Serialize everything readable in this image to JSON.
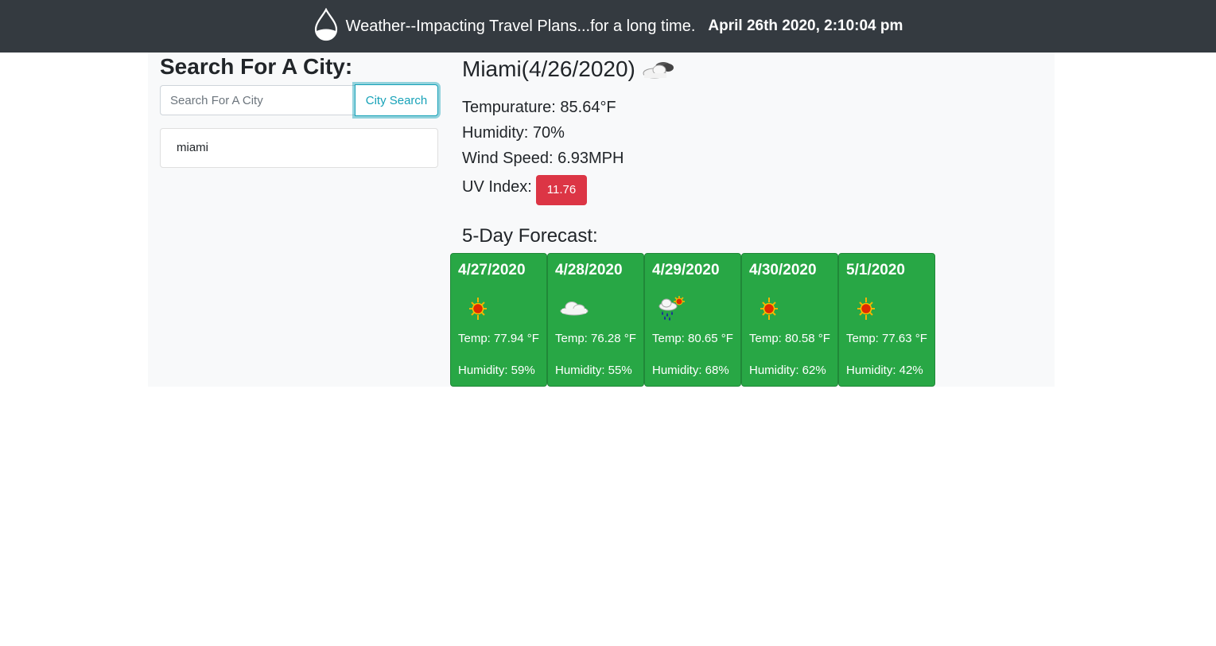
{
  "header": {
    "title": "Weather--Impacting Travel Plans...for a long time.",
    "datetime": "April 26th 2020, 2:10:04 pm",
    "logo_icon": "water-drop-icon"
  },
  "search": {
    "heading": "Search For A City:",
    "placeholder": "Search For A City",
    "button_label": "City Search",
    "history": [
      "miami"
    ]
  },
  "current": {
    "city_heading": "Miami(4/26/2020)",
    "icon": "partly-cloudy-icon",
    "temperature": "Tempurature: 85.64°F",
    "humidity": "Humidity: 70%",
    "wind": "Wind Speed: 6.93MPH",
    "uv_label": "UV Index:",
    "uv_value": "11.76",
    "uv_color": "#dc3545"
  },
  "forecast": {
    "heading": "5-Day Forecast:",
    "card_color": "#28a745",
    "days": [
      {
        "date": "4/27/2020",
        "icon": "sun-icon",
        "temp": "Temp: 77.94 °F",
        "humidity": "Humidity: 59%"
      },
      {
        "date": "4/28/2020",
        "icon": "cloud-icon",
        "temp": "Temp: 76.28 °F",
        "humidity": "Humidity: 55%"
      },
      {
        "date": "4/29/2020",
        "icon": "rain-sun-icon",
        "temp": "Temp: 80.65 °F",
        "humidity": "Humidity: 68%"
      },
      {
        "date": "4/30/2020",
        "icon": "sun-icon",
        "temp": "Temp: 80.58 °F",
        "humidity": "Humidity: 62%"
      },
      {
        "date": "5/1/2020",
        "icon": "sun-icon",
        "temp": "Temp: 77.63 °F",
        "humidity": "Humidity: 42%"
      }
    ]
  }
}
